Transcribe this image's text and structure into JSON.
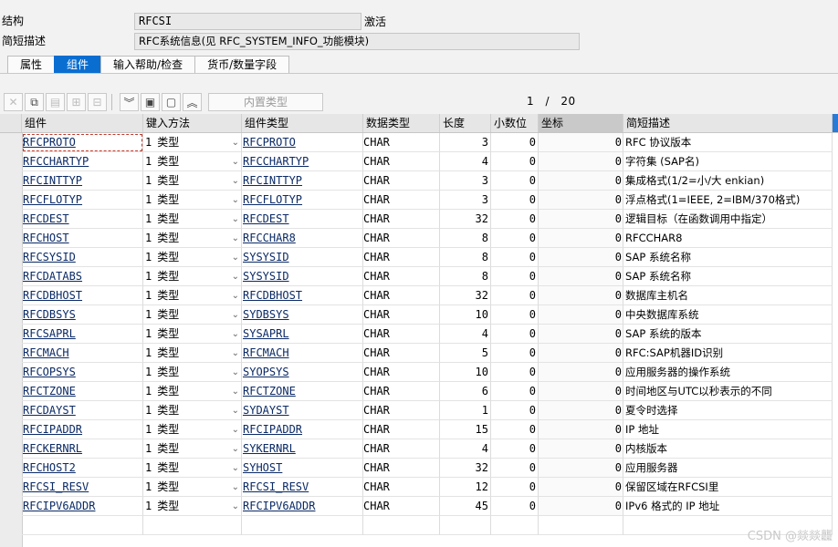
{
  "header": {
    "structure_label": "结构",
    "structure_value": "RFCSI",
    "status": "激活",
    "short_desc_label": "简短描述",
    "short_desc_value": "RFC系统信息(见 RFC_SYSTEM_INFO_功能模块)"
  },
  "tabs": [
    "属性",
    "组件",
    "输入帮助/检查",
    "货币/数量字段"
  ],
  "active_tab": "组件",
  "toolbar": {
    "builtin_type_label": "内置类型",
    "page_current": "1",
    "page_sep": "/",
    "page_total": "20"
  },
  "grid": {
    "headers": [
      "组件",
      "键入方法",
      "组件类型",
      "数据类型",
      "长度",
      "小数位",
      "坐标",
      "简短描述"
    ],
    "rows": [
      {
        "component": "RFCPROTO",
        "entry_num": "1",
        "entry_type": "类型",
        "comp_type": "RFCPROTO",
        "data_type": "CHAR",
        "length": "3",
        "decimals": "0",
        "coord": "0",
        "desc": "RFC 协议版本"
      },
      {
        "component": "RFCCHARTYP",
        "entry_num": "1",
        "entry_type": "类型",
        "comp_type": "RFCCHARTYP",
        "data_type": "CHAR",
        "length": "4",
        "decimals": "0",
        "coord": "0",
        "desc": "字符集 (SAP名)"
      },
      {
        "component": "RFCINTTYP",
        "entry_num": "1",
        "entry_type": "类型",
        "comp_type": "RFCINTTYP",
        "data_type": "CHAR",
        "length": "3",
        "decimals": "0",
        "coord": "0",
        "desc": "集成格式(1/2=小/大 enkian)"
      },
      {
        "component": "RFCFLOTYP",
        "entry_num": "1",
        "entry_type": "类型",
        "comp_type": "RFCFLOTYP",
        "data_type": "CHAR",
        "length": "3",
        "decimals": "0",
        "coord": "0",
        "desc": "浮点格式(1=IEEE, 2=IBM/370格式)"
      },
      {
        "component": "RFCDEST",
        "entry_num": "1",
        "entry_type": "类型",
        "comp_type": "RFCDEST",
        "data_type": "CHAR",
        "length": "32",
        "decimals": "0",
        "coord": "0",
        "desc": "逻辑目标（在函数调用中指定）"
      },
      {
        "component": "RFCHOST",
        "entry_num": "1",
        "entry_type": "类型",
        "comp_type": "RFCCHAR8",
        "data_type": "CHAR",
        "length": "8",
        "decimals": "0",
        "coord": "0",
        "desc": "RFCCHAR8"
      },
      {
        "component": "RFCSYSID",
        "entry_num": "1",
        "entry_type": "类型",
        "comp_type": "SYSYSID",
        "data_type": "CHAR",
        "length": "8",
        "decimals": "0",
        "coord": "0",
        "desc": "SAP 系统名称"
      },
      {
        "component": "RFCDATABS",
        "entry_num": "1",
        "entry_type": "类型",
        "comp_type": "SYSYSID",
        "data_type": "CHAR",
        "length": "8",
        "decimals": "0",
        "coord": "0",
        "desc": "SAP 系统名称"
      },
      {
        "component": "RFCDBHOST",
        "entry_num": "1",
        "entry_type": "类型",
        "comp_type": "RFCDBHOST",
        "data_type": "CHAR",
        "length": "32",
        "decimals": "0",
        "coord": "0",
        "desc": "数据库主机名"
      },
      {
        "component": "RFCDBSYS",
        "entry_num": "1",
        "entry_type": "类型",
        "comp_type": "SYDBSYS",
        "data_type": "CHAR",
        "length": "10",
        "decimals": "0",
        "coord": "0",
        "desc": "中央数据库系统"
      },
      {
        "component": "RFCSAPRL",
        "entry_num": "1",
        "entry_type": "类型",
        "comp_type": "SYSAPRL",
        "data_type": "CHAR",
        "length": "4",
        "decimals": "0",
        "coord": "0",
        "desc": "SAP 系统的版本"
      },
      {
        "component": "RFCMACH",
        "entry_num": "1",
        "entry_type": "类型",
        "comp_type": "RFCMACH",
        "data_type": "CHAR",
        "length": "5",
        "decimals": "0",
        "coord": "0",
        "desc": "RFC:SAP机器ID识别"
      },
      {
        "component": "RFCOPSYS",
        "entry_num": "1",
        "entry_type": "类型",
        "comp_type": "SYOPSYS",
        "data_type": "CHAR",
        "length": "10",
        "decimals": "0",
        "coord": "0",
        "desc": "应用服务器的操作系统"
      },
      {
        "component": "RFCTZONE",
        "entry_num": "1",
        "entry_type": "类型",
        "comp_type": "RFCTZONE",
        "data_type": "CHAR",
        "length": "6",
        "decimals": "0",
        "coord": "0",
        "desc": "时间地区与UTC以秒表示的不同"
      },
      {
        "component": "RFCDAYST",
        "entry_num": "1",
        "entry_type": "类型",
        "comp_type": "SYDAYST",
        "data_type": "CHAR",
        "length": "1",
        "decimals": "0",
        "coord": "0",
        "desc": "夏令时选择"
      },
      {
        "component": "RFCIPADDR",
        "entry_num": "1",
        "entry_type": "类型",
        "comp_type": "RFCIPADDR",
        "data_type": "CHAR",
        "length": "15",
        "decimals": "0",
        "coord": "0",
        "desc": "IP 地址"
      },
      {
        "component": "RFCKERNRL",
        "entry_num": "1",
        "entry_type": "类型",
        "comp_type": "SYKERNRL",
        "data_type": "CHAR",
        "length": "4",
        "decimals": "0",
        "coord": "0",
        "desc": "内核版本"
      },
      {
        "component": "RFCHOST2",
        "entry_num": "1",
        "entry_type": "类型",
        "comp_type": "SYHOST",
        "data_type": "CHAR",
        "length": "32",
        "decimals": "0",
        "coord": "0",
        "desc": "应用服务器"
      },
      {
        "component": "RFCSI_RESV",
        "entry_num": "1",
        "entry_type": "类型",
        "comp_type": "RFCSI_RESV",
        "data_type": "CHAR",
        "length": "12",
        "decimals": "0",
        "coord": "0",
        "desc": "保留区域在RFCSI里"
      },
      {
        "component": "RFCIPV6ADDR",
        "entry_num": "1",
        "entry_type": "类型",
        "comp_type": "RFCIPV6ADDR",
        "data_type": "CHAR",
        "length": "45",
        "decimals": "0",
        "coord": "0",
        "desc": "IPv6 格式的 IP 地址"
      }
    ]
  },
  "watermark": "CSDN @燚燚龘",
  "colors": {
    "active_tab": "#0a6ed1",
    "header_bg": "#e6e6e6",
    "link": "#0b2a66"
  }
}
